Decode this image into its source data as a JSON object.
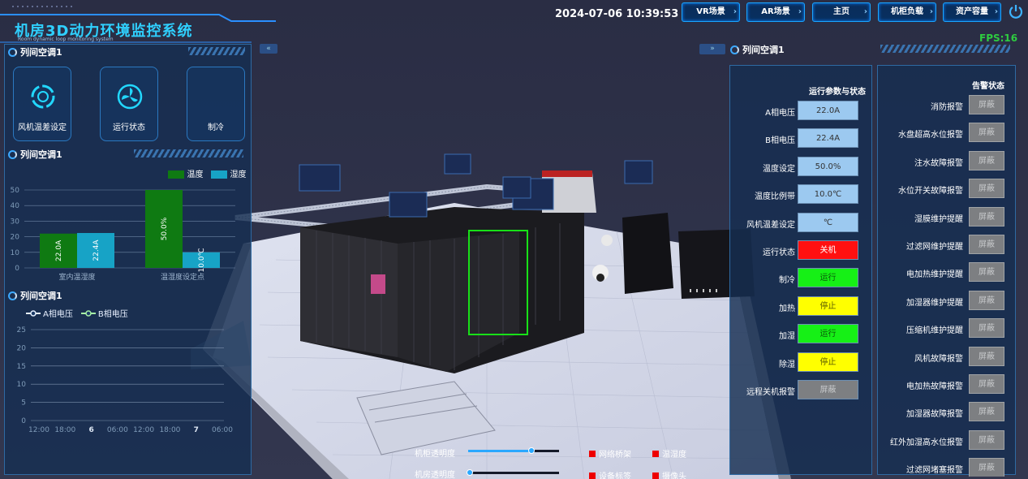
{
  "header": {
    "title": "机房3D动力环境监控系统",
    "subtitle": "Room dynamic loop monitoring system",
    "datetime": "2024-07-06 10:39:53",
    "nav": [
      "VR场景",
      "AR场景",
      "主页",
      "机柜负载",
      "资产容量"
    ],
    "fps": "FPS:16"
  },
  "left": {
    "section1_title": "列间空调1",
    "buttons": [
      "风机温差设定",
      "运行状态",
      "制冷"
    ],
    "section2_title": "列间空调1",
    "chart_legend": [
      "温度",
      "湿度"
    ],
    "section3_title": "列间空调1",
    "line_legend": [
      "A相电压",
      "B相电压"
    ]
  },
  "chart_data": [
    {
      "type": "bar",
      "title": "",
      "categories": [
        "室内温湿度",
        "温湿度设定点"
      ],
      "series": [
        {
          "name": "温度",
          "values": [
            22.0,
            50.0
          ],
          "labels": [
            "22.0A",
            "50.0%"
          ],
          "color": "#0f7a12"
        },
        {
          "name": "湿度",
          "values": [
            22.4,
            10.0
          ],
          "labels": [
            "22.4A",
            "10.0℃"
          ],
          "color": "#17a3c6"
        }
      ],
      "yticks": [
        0,
        10,
        20,
        30,
        40,
        50
      ],
      "ylim": [
        0,
        50
      ],
      "grid": true,
      "legend": "top-right"
    },
    {
      "type": "line",
      "title": "",
      "series": [
        {
          "name": "A相电压",
          "values": []
        },
        {
          "name": "B相电压",
          "values": []
        }
      ],
      "xticks": [
        "12:00",
        "18:00",
        "6",
        "06:00",
        "12:00",
        "18:00",
        "7",
        "06:00"
      ],
      "yticks": [
        0,
        5,
        10,
        15,
        20,
        25
      ],
      "ylim": [
        0,
        25
      ],
      "grid": true,
      "legend": "top-left"
    }
  ],
  "scene": {
    "slider1": "机柜透明度",
    "slider2": "机房透明度",
    "slider1_value": 0.7,
    "slider2_value": 0.02,
    "toggles": [
      "网络桥架",
      "温湿度",
      "设备标签",
      "摄像头"
    ]
  },
  "right": {
    "header_title": "列间空调1",
    "params_title": "运行参数与状态",
    "params": [
      {
        "k": "A相电压",
        "v": "22.0A",
        "c": "#9cc9f0",
        "t": "#333"
      },
      {
        "k": "B相电压",
        "v": "22.4A",
        "c": "#9cc9f0",
        "t": "#333"
      },
      {
        "k": "温度设定",
        "v": "50.0%",
        "c": "#9cc9f0",
        "t": "#333"
      },
      {
        "k": "温度比例带",
        "v": "10.0℃",
        "c": "#9cc9f0",
        "t": "#333"
      },
      {
        "k": "风机温差设定",
        "v": "℃",
        "c": "#9cc9f0",
        "t": "#333"
      },
      {
        "k": "运行状态",
        "v": "关机",
        "c": "#ff1010",
        "t": "#fff"
      },
      {
        "k": "制冷",
        "v": "运行",
        "c": "#16f016",
        "t": "#0a5a0a"
      },
      {
        "k": "加热",
        "v": "停止",
        "c": "#ffff00",
        "t": "#5a5a00"
      },
      {
        "k": "加湿",
        "v": "运行",
        "c": "#16f016",
        "t": "#0a5a0a"
      },
      {
        "k": "除湿",
        "v": "停止",
        "c": "#ffff00",
        "t": "#5a5a00"
      },
      {
        "k": "远程关机报警",
        "v": "屏蔽",
        "c": "#7d7f82",
        "t": "#c8cacc"
      }
    ],
    "alarm_title": "告警状态",
    "alarms": [
      {
        "k": "消防报警",
        "v": "屏蔽"
      },
      {
        "k": "水盘超高水位报警",
        "v": "屏蔽"
      },
      {
        "k": "注水故障报警",
        "v": "屏蔽"
      },
      {
        "k": "水位开关故障报警",
        "v": "屏蔽"
      },
      {
        "k": "湿膜维护提醒",
        "v": "屏蔽"
      },
      {
        "k": "过滤网维护提醒",
        "v": "屏蔽"
      },
      {
        "k": "电加热维护提醒",
        "v": "屏蔽"
      },
      {
        "k": "加湿器维护提醒",
        "v": "屏蔽"
      },
      {
        "k": "压缩机维护提醒",
        "v": "屏蔽"
      },
      {
        "k": "风机故障报警",
        "v": "屏蔽"
      },
      {
        "k": "电加热故障报警",
        "v": "屏蔽"
      },
      {
        "k": "加湿器故障报警",
        "v": "屏蔽"
      },
      {
        "k": "红外加湿高水位报警",
        "v": "屏蔽"
      },
      {
        "k": "过滤网堵塞报警",
        "v": "屏蔽"
      }
    ]
  }
}
